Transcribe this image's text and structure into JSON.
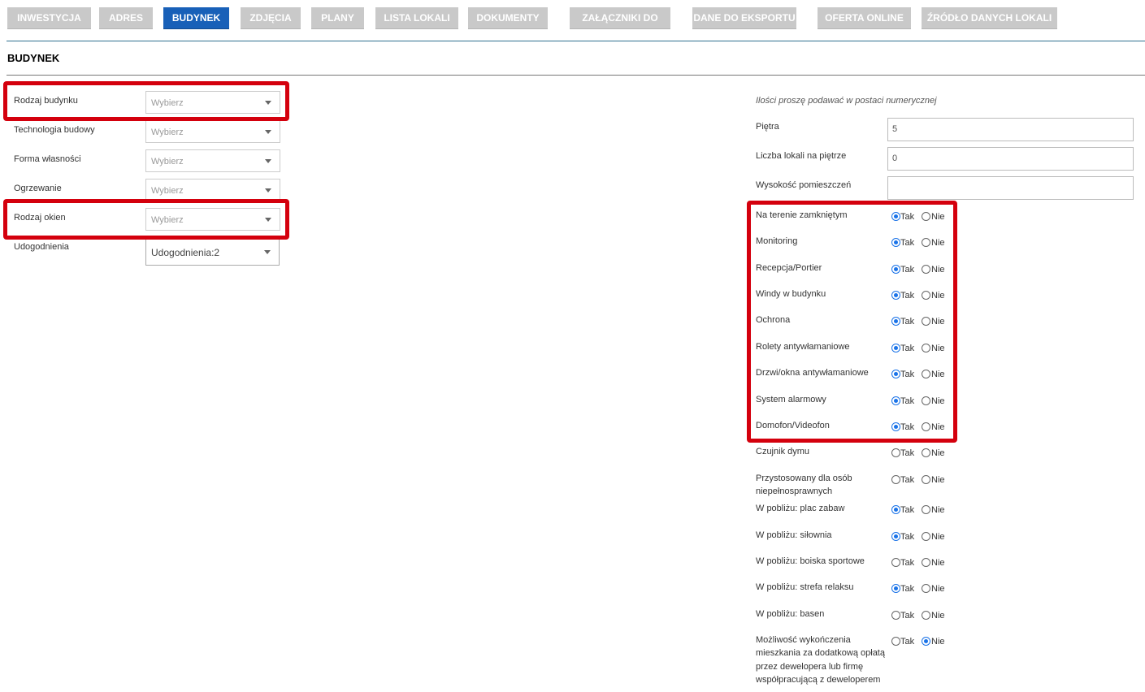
{
  "tabs": [
    {
      "label": "INWESTYCJA",
      "active": false
    },
    {
      "label": "ADRES",
      "active": false
    },
    {
      "label": "BUDYNEK",
      "active": true
    },
    {
      "label": "ZDJĘCIA",
      "active": false
    },
    {
      "label": "PLANY",
      "active": false
    },
    {
      "label": "LISTA LOKALI",
      "active": false
    },
    {
      "label": "DOKUMENTY",
      "active": false
    },
    {
      "label": "ZAŁĄCZNIKI DO OFERT",
      "active": false
    },
    {
      "label": "DANE DO EKSPORTU",
      "active": false
    },
    {
      "label": "OFERTA ONLINE",
      "active": false
    },
    {
      "label": "ŹRÓDŁO DANYCH LOKALI",
      "active": false
    }
  ],
  "section_title": "BUDYNEK",
  "left_fields": [
    {
      "label": "Rodzaj budynku",
      "value": "Wybierz"
    },
    {
      "label": "Technologia budowy",
      "value": "Wybierz"
    },
    {
      "label": "Forma własności",
      "value": "Wybierz"
    },
    {
      "label": "Ogrzewanie",
      "value": "Wybierz"
    },
    {
      "label": "Rodzaj okien",
      "value": "Wybierz"
    },
    {
      "label": "Udogodnienia",
      "value": "Udogodnienia:2"
    }
  ],
  "note": "Ilości proszę podawać w postaci numerycznej",
  "numeric_fields": [
    {
      "label": "Piętra",
      "value": "5"
    },
    {
      "label": "Liczba lokali na piętrze",
      "value": "0"
    },
    {
      "label": "Wysokość pomieszczeń",
      "value": ""
    }
  ],
  "yes_label": "Tak",
  "no_label": "Nie",
  "options": [
    {
      "label": "Na terenie zamkniętym",
      "lines": [
        "Na terenie zamkniętym"
      ],
      "value": "Tak"
    },
    {
      "label": "Monitoring",
      "lines": [
        "Monitoring"
      ],
      "value": "Tak"
    },
    {
      "label": "Recepcja/Portier",
      "lines": [
        "Recepcja/Portier"
      ],
      "value": "Tak"
    },
    {
      "label": "Windy w budynku",
      "lines": [
        "Windy w budynku"
      ],
      "value": "Tak"
    },
    {
      "label": "Ochrona",
      "lines": [
        "Ochrona"
      ],
      "value": "Tak"
    },
    {
      "label": "Rolety antywłamaniowe",
      "lines": [
        "Rolety antywłamaniowe"
      ],
      "value": "Tak"
    },
    {
      "label": "Drzwi/okna antywłamaniowe",
      "lines": [
        "Drzwi/okna antywłamaniowe"
      ],
      "value": "Tak"
    },
    {
      "label": "System alarmowy",
      "lines": [
        "System alarmowy"
      ],
      "value": "Tak"
    },
    {
      "label": "Domofon/Videofon",
      "lines": [
        "Domofon/Videofon"
      ],
      "value": "Tak"
    },
    {
      "label": "Czujnik dymu",
      "lines": [
        "Czujnik dymu"
      ],
      "value": ""
    },
    {
      "label": "Przystosowany dla osób niepełnosprawnych",
      "lines": [
        "Przystosowany dla osób",
        "niepełnosprawnych"
      ],
      "value": ""
    },
    {
      "label": "W pobliżu: plac zabaw",
      "lines": [
        "W pobliżu: plac zabaw"
      ],
      "value": "Tak"
    },
    {
      "label": "W pobliżu: siłownia",
      "lines": [
        "W pobliżu: siłownia"
      ],
      "value": "Tak"
    },
    {
      "label": "W pobliżu: boiska sportowe",
      "lines": [
        "W pobliżu: boiska sportowe"
      ],
      "value": ""
    },
    {
      "label": "W pobliżu: strefa relaksu",
      "lines": [
        "W pobliżu: strefa relaksu"
      ],
      "value": "Tak"
    },
    {
      "label": "W pobliżu: basen",
      "lines": [
        "W pobliżu: basen"
      ],
      "value": ""
    },
    {
      "label": "Możliwość wykończenia mieszkania za dodatkową opłatą przez dewelopera lub firmę współpracującą z deweloperem",
      "lines": [
        "Możliwość wykończenia",
        "mieszkania za dodatkową opłatą",
        "przez dewelopera lub firmę",
        "współpracującą z deweloperem"
      ],
      "value": "Nie"
    }
  ],
  "colors": {
    "tab_bg": "#c9c9c9",
    "tab_active_bg": "#1860b8",
    "highlight": "#d4000d",
    "radio_accent": "#1a73e8"
  }
}
